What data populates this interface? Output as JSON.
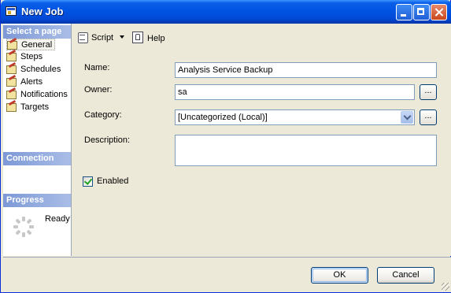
{
  "window": {
    "title": "New Job"
  },
  "sidebar": {
    "select_page_header": "Select a page",
    "pages": [
      {
        "label": "General",
        "selected": true
      },
      {
        "label": "Steps"
      },
      {
        "label": "Schedules"
      },
      {
        "label": "Alerts"
      },
      {
        "label": "Notifications"
      },
      {
        "label": "Targets"
      }
    ],
    "connection_header": "Connection",
    "progress_header": "Progress",
    "progress_status": "Ready"
  },
  "toolbar": {
    "script_label": "Script",
    "help_label": "Help"
  },
  "form": {
    "name_label": "Name:",
    "name_value": "Analysis Service Backup",
    "owner_label": "Owner:",
    "owner_value": "sa",
    "category_label": "Category:",
    "category_value": "[Uncategorized (Local)]",
    "description_label": "Description:",
    "description_value": "",
    "browse_label": "...",
    "enabled_label": "Enabled",
    "enabled_checked": true
  },
  "buttons": {
    "ok": "OK",
    "cancel": "Cancel"
  },
  "colors": {
    "title_bar": "#0054e3",
    "header_band": "#7d99d6",
    "face": "#ece9d8"
  }
}
